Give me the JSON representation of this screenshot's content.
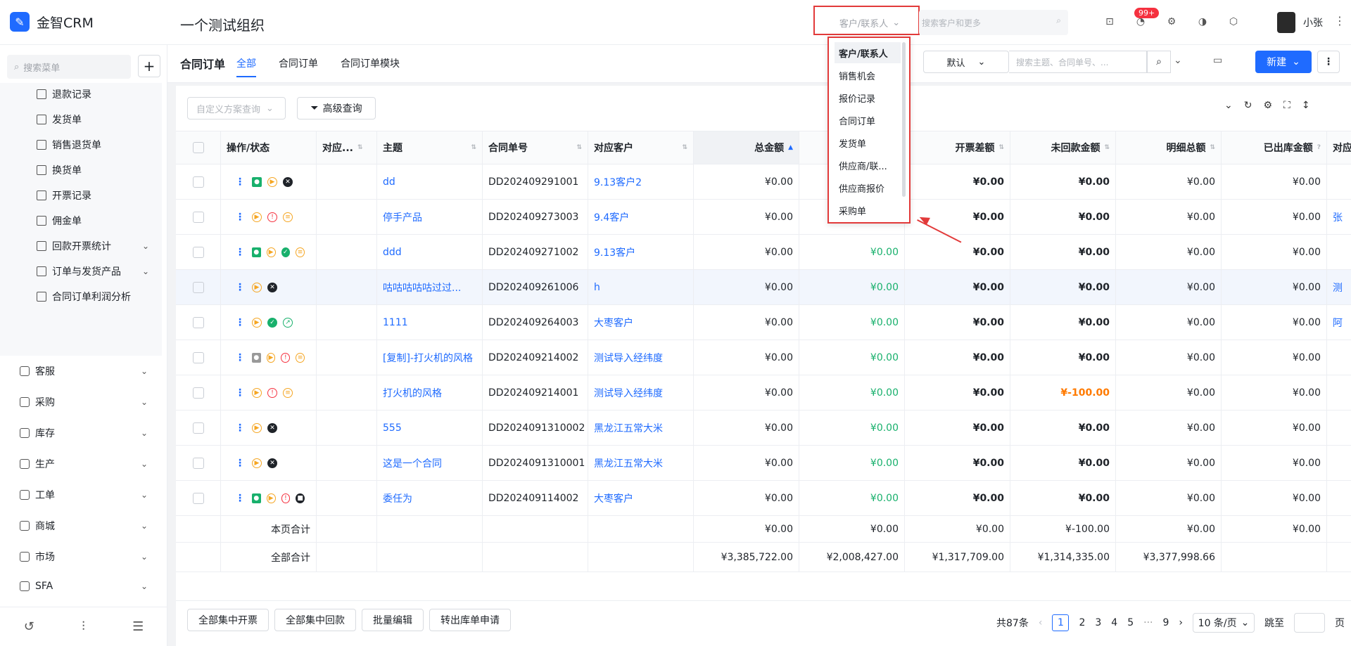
{
  "app": {
    "logo_text": "金智CRM",
    "org_name": "一个测试组织",
    "user_name": "小张",
    "notif_badge": "99+"
  },
  "search": {
    "type_label": "客户/联系人",
    "placeholder": "搜索客户和更多"
  },
  "dropdown": {
    "items": [
      "客户/联系人",
      "销售机会",
      "报价记录",
      "合同订单",
      "发货单",
      "供应商/联...",
      "供应商报价",
      "采购单"
    ]
  },
  "sidebar": {
    "search_placeholder": "搜索菜单",
    "sub_items": [
      "退款记录",
      "发货单",
      "销售退货单",
      "换货单",
      "开票记录",
      "佣金单",
      "回款开票统计",
      "订单与发货产品",
      "合同订单利润分析"
    ],
    "main_items": [
      "客服",
      "采购",
      "库存",
      "生产",
      "工单",
      "商城",
      "市场",
      "SFA"
    ]
  },
  "page": {
    "title": "合同订单",
    "tabs": [
      "全部",
      "合同订单",
      "合同订单模块"
    ]
  },
  "toolbar": {
    "view_select": "默认",
    "search_placeholder": "搜索主题、合同单号、...",
    "new_label": "新建",
    "filter_placeholder": "自定义方案查询",
    "advanced_label": "高级查询"
  },
  "table": {
    "headers": [
      "操作/状态",
      "对应...",
      "主题",
      "合同单号",
      "对应客户",
      "总金额",
      "",
      "开票差额",
      "未回款金额",
      "明细总额",
      "已出库金额",
      "对应"
    ],
    "rows": [
      {
        "subject": "dd",
        "no": "DD202409291001",
        "customer": "9.13客户2",
        "total": "¥0.00",
        "col6": "",
        "inv_diff": "¥0.00",
        "unpaid": "¥0.00",
        "detail": "¥0.00",
        "outbound": "¥0.00",
        "extra": ""
      },
      {
        "subject": "停手产品",
        "no": "DD202409273003",
        "customer": "9.4客户",
        "total": "¥0.00",
        "col6": "",
        "inv_diff": "¥0.00",
        "unpaid": "¥0.00",
        "detail": "¥0.00",
        "outbound": "¥0.00",
        "extra": "张"
      },
      {
        "subject": "ddd",
        "no": "DD202409271002",
        "customer": "9.13客户",
        "total": "¥0.00",
        "col6": "¥0.00",
        "inv_diff": "¥0.00",
        "unpaid": "¥0.00",
        "detail": "¥0.00",
        "outbound": "¥0.00",
        "extra": ""
      },
      {
        "subject": "咕咕咕咕咕过过...",
        "no": "DD202409261006",
        "customer": "h",
        "total": "¥0.00",
        "col6": "¥0.00",
        "inv_diff": "¥0.00",
        "unpaid": "¥0.00",
        "detail": "¥0.00",
        "outbound": "¥0.00",
        "extra": "测"
      },
      {
        "subject": "1111",
        "no": "DD202409264003",
        "customer": "大枣客户",
        "total": "¥0.00",
        "col6": "¥0.00",
        "inv_diff": "¥0.00",
        "unpaid": "¥0.00",
        "detail": "¥0.00",
        "outbound": "¥0.00",
        "extra": "阿"
      },
      {
        "subject": "[复制]-打火机的风格",
        "no": "DD202409214002",
        "customer": "测试导入经纬度",
        "total": "¥0.00",
        "col6": "¥0.00",
        "inv_diff": "¥0.00",
        "unpaid": "¥0.00",
        "detail": "¥0.00",
        "outbound": "¥0.00",
        "extra": ""
      },
      {
        "subject": "打火机的风格",
        "no": "DD202409214001",
        "customer": "测试导入经纬度",
        "total": "¥0.00",
        "col6": "¥0.00",
        "inv_diff": "¥0.00",
        "unpaid": "¥-100.00",
        "detail": "¥0.00",
        "outbound": "¥0.00",
        "extra": ""
      },
      {
        "subject": "555",
        "no": "DD2024091310002",
        "customer": "黑龙江五常大米",
        "total": "¥0.00",
        "col6": "¥0.00",
        "inv_diff": "¥0.00",
        "unpaid": "¥0.00",
        "detail": "¥0.00",
        "outbound": "¥0.00",
        "extra": ""
      },
      {
        "subject": "这是一个合同",
        "no": "DD2024091310001",
        "customer": "黑龙江五常大米",
        "total": "¥0.00",
        "col6": "¥0.00",
        "inv_diff": "¥0.00",
        "unpaid": "¥0.00",
        "detail": "¥0.00",
        "outbound": "¥0.00",
        "extra": ""
      },
      {
        "subject": "委任为",
        "no": "DD202409114002",
        "customer": "大枣客户",
        "total": "¥0.00",
        "col6": "¥0.00",
        "inv_diff": "¥0.00",
        "unpaid": "¥0.00",
        "detail": "¥0.00",
        "outbound": "¥0.00",
        "extra": ""
      }
    ],
    "page_total": {
      "label": "本页合计",
      "total": "¥0.00",
      "col6": "¥0.00",
      "inv_diff": "¥0.00",
      "unpaid": "¥-100.00",
      "detail": "¥0.00",
      "outbound": "¥0.00"
    },
    "all_total": {
      "label": "全部合计",
      "total": "¥3,385,722.00",
      "col6": "¥2,008,427.00",
      "inv_diff": "¥1,317,709.00",
      "unpaid": "¥1,314,335.00",
      "detail": "¥3,377,998.66"
    }
  },
  "bottom": {
    "buttons": [
      "全部集中开票",
      "全部集中回款",
      "批量编辑",
      "转出库单申请"
    ],
    "pager": {
      "total": "共87条",
      "pages": [
        "1",
        "2",
        "3",
        "4",
        "5",
        "···",
        "9"
      ],
      "size": "10 条/页",
      "goto": "跳至",
      "page_suffix": "页"
    }
  }
}
